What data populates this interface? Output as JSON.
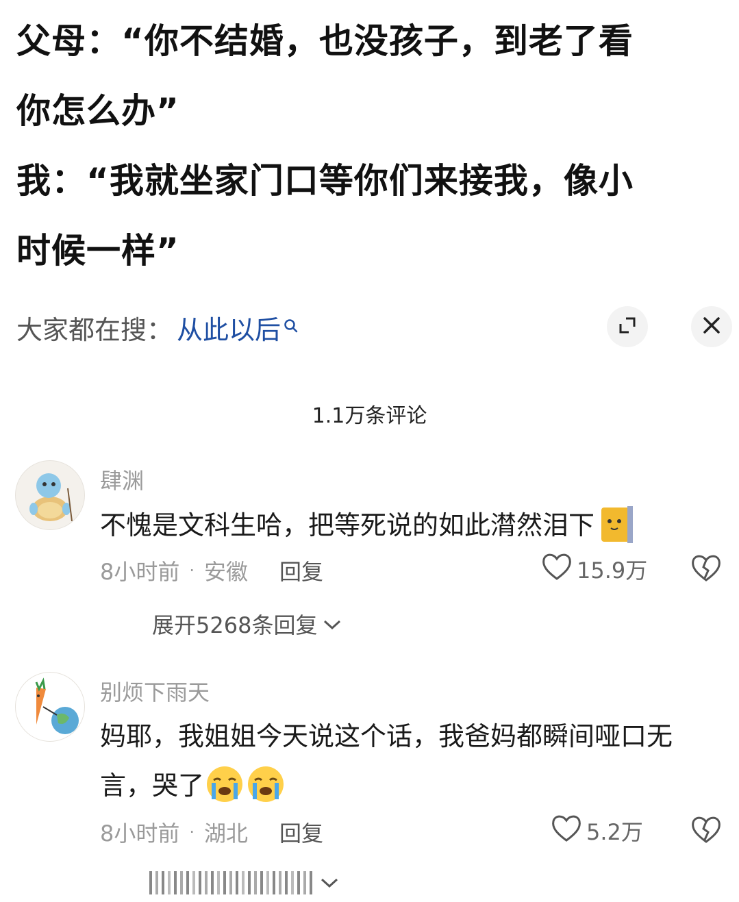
{
  "post": {
    "lines": [
      "父母：“你不结婚，也没孩子，到老了看",
      "你怎么办”",
      "我：“我就坐家门口等你们来接我，像小",
      "时候一样”"
    ]
  },
  "search": {
    "prefix": "大家都在搜：",
    "term": "从此以后"
  },
  "comments_header": {
    "count_label": "1.1万条评论"
  },
  "comments": [
    {
      "username": "肆渊",
      "text": "不愧是文科生哈，把等死说的如此潸然泪下",
      "time": "8小时前",
      "location": "安徽",
      "reply_label": "回复",
      "likes": "15.9万",
      "expand_label": "展开5268条回复"
    },
    {
      "username": "别烦下雨天",
      "text_line1": "妈耶，我姐姐今天说这个话，我爸妈都瞬间哑口无",
      "text_line2": "言，哭了",
      "time": "8小时前",
      "location": "湖北",
      "reply_label": "回复",
      "likes": "5.2万"
    }
  ],
  "colors": {
    "accent_link": "#1f4fa3",
    "muted_text": "#9a9a9a",
    "primary_text": "#1a1a1a"
  },
  "icons": [
    "search-icon",
    "expand-icon",
    "close-icon",
    "heart-icon",
    "broken-heart-icon",
    "chevron-down-icon",
    "cat-emoji-icon",
    "crying-emoji-icon"
  ]
}
